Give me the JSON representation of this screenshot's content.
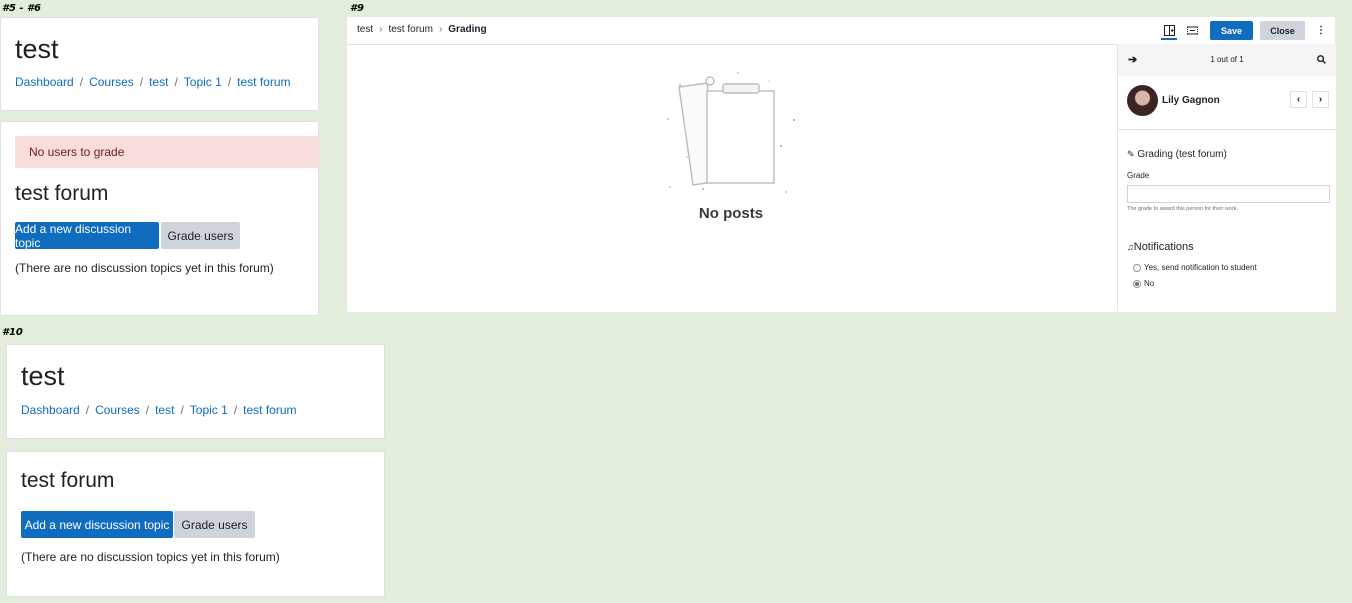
{
  "labels": {
    "first": "#5 - #6",
    "grading": "#9",
    "second": "#10"
  },
  "course": {
    "title": "test",
    "breadcrumb": [
      "Dashboard",
      "Courses",
      "test",
      "Topic 1",
      "test forum"
    ],
    "breadcrumb_sep": "/"
  },
  "forum_panel_a": {
    "alert": "No users to grade",
    "forum_title": "test forum",
    "add_button": "Add a new discussion topic",
    "grade_button": "Grade users",
    "empty_note": "(There are no discussion topics yet in this forum)"
  },
  "forum_panel_b": {
    "forum_title": "test forum",
    "add_button": "Add a new discussion topic",
    "grade_button": "Grade users",
    "empty_note": "(There are no discussion topics yet in this forum)"
  },
  "grading": {
    "breadcrumb": [
      "test",
      "test forum",
      "Grading"
    ],
    "breadcrumb_sep": "›",
    "toolbar": {
      "collapse_grader_icon": "collapse-grader-icon",
      "collapse_review_icon": "collapse-review-icon",
      "save": "Save",
      "close": "Close",
      "more_icon": "kebab-menu-icon"
    },
    "empty_posts": "No posts",
    "side_panel": {
      "pager": "1 out of 1",
      "user_name": "Lily Gagnon",
      "grading_title": "Grading (test forum)",
      "grade_label": "Grade",
      "grade_value": "",
      "grade_help": "The grade to award this person for their work.",
      "notifications_title": "Notifications",
      "notify_yes": "Yes, send notification to student",
      "notify_no": "No",
      "notify_selected": "No"
    }
  },
  "colors": {
    "background": "#e2eedb",
    "primary": "#0f6cbf",
    "secondary": "#ced4da",
    "alert_bg": "#f7dddc"
  }
}
